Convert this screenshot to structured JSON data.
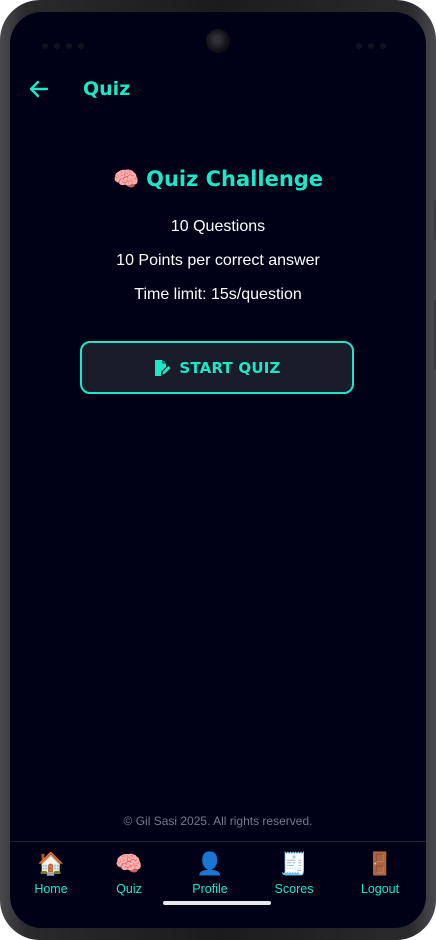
{
  "app": {
    "header_title": "Quiz",
    "accent_color": "#1ce8c8",
    "background_color": "#000016"
  },
  "quiz": {
    "emoji": "🧠",
    "title": "Quiz Challenge",
    "questions_text": "10 Questions",
    "points_text": "10 Points per correct answer",
    "time_limit_text": "Time limit: 15s/question",
    "start_button_label": "START QUIZ",
    "start_button_icon": "edit-note-icon"
  },
  "footer": {
    "copyright": "© Gil Sasi 2025. All rights reserved."
  },
  "bottom_nav": {
    "items": [
      {
        "emoji": "🏠",
        "label": "Home",
        "icon": "home-icon"
      },
      {
        "emoji": "🧠",
        "label": "Quiz",
        "icon": "brain-icon"
      },
      {
        "emoji": "👤",
        "label": "Profile",
        "icon": "user-icon"
      },
      {
        "emoji": "🧾",
        "label": "Scores",
        "icon": "receipt-icon"
      },
      {
        "emoji": "🚪",
        "label": "Logout",
        "icon": "door-icon"
      }
    ]
  }
}
